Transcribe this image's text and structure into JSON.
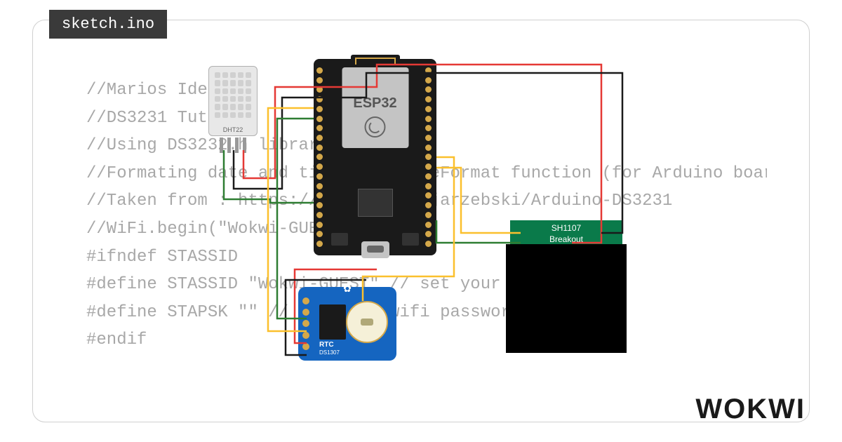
{
  "tab_title": "sketch.ino",
  "brand": "WOKWI",
  "code_lines": [
    "//Marios Ideas",
    "//DS3231 Tutorial",
    "//Using DS3232.h library",
    "//Formating date and time with dateFormat function (for Arduino board",
    "//Taken from : https://github.com/jarzebski/Arduino-DS3231",
    "//WiFi.begin(\"Wokwi-GUEST\", \"\", 6);",
    "#ifndef STASSID",
    "#define STASSID \"Wokwi-GUEST\"          // set your SSID",
    "#define STAPSK  \"\"                    // set your wifi password",
    "#endif"
  ],
  "components": {
    "esp32_label": "ESP32",
    "dht22_label": "DHT22",
    "sh1107_label_line1": "SH1107",
    "sh1107_label_line2": "Breakout",
    "rtc_label_line1": "RTC",
    "rtc_label_line2": "DS1307"
  }
}
